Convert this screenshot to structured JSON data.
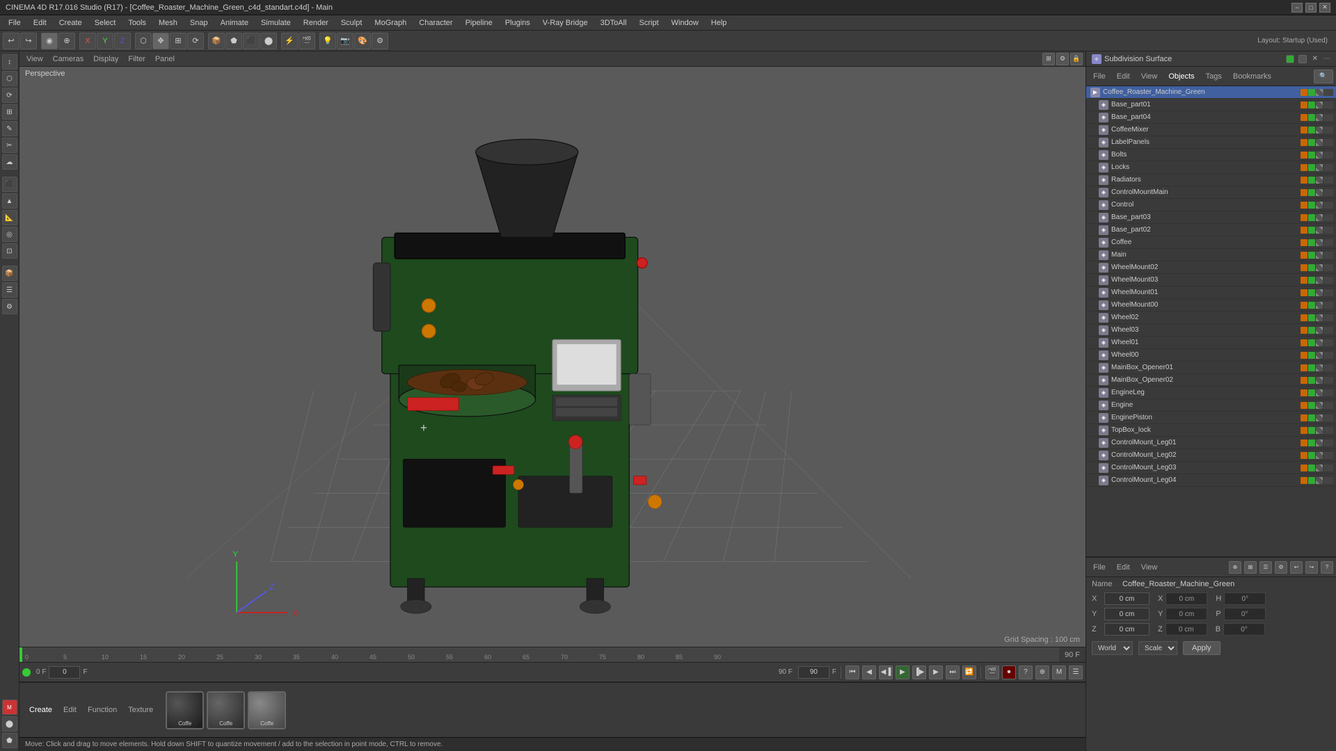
{
  "titlebar": {
    "title": "CINEMA 4D R17.016 Studio (R17) - [Coffee_Roaster_Machine_Green_c4d_standart.c4d] - Main",
    "min": "−",
    "max": "□",
    "close": "✕"
  },
  "menubar": {
    "items": [
      "File",
      "Edit",
      "Create",
      "Select",
      "Tools",
      "Mesh",
      "Snap",
      "Animate",
      "Simulate",
      "Render",
      "Sculpt",
      "MoGraph",
      "Character",
      "Pipeline",
      "Plugins",
      "V-Ray Bridge",
      "3DToAll",
      "Script",
      "Window",
      "Help"
    ]
  },
  "layout": {
    "label": "Layout: Startup (Used)"
  },
  "icons": {
    "undo": "↩",
    "redo": "↪",
    "move": "✥",
    "scale": "⊞",
    "rotate": "⟳",
    "play": "▶",
    "stop": "■",
    "rewind": "◀◀",
    "render": "⚡"
  },
  "viewport": {
    "perspective": "Perspective",
    "tabs": [
      "View",
      "Cameras",
      "Display",
      "Filter",
      "Panel"
    ],
    "grid_spacing": "Grid Spacing : 100 cm"
  },
  "toolbar_main": {
    "buttons": [
      "↩",
      "↪",
      "⊙",
      "◉",
      "🔄",
      "X",
      "Y",
      "Z",
      "📦",
      "✋",
      "🖊",
      "🔺",
      "⬡",
      "🔲",
      "💡",
      "🎬",
      "🏃",
      "📷",
      "⚙"
    ]
  },
  "left_tools": {
    "items": [
      "↕",
      "⬡",
      "⟳",
      "⊞",
      "✎",
      "✂",
      "☁",
      "⬛",
      "▲",
      "📐",
      "◎",
      "⊡",
      "📦",
      "☰",
      "⚙",
      "⬤"
    ]
  },
  "object_manager": {
    "tabs": [
      "File",
      "Edit",
      "View",
      "Objects",
      "Tags",
      "Bookmarks"
    ],
    "active_tab": "Objects",
    "subdiv_surface": "Subdivision Surface",
    "objects": [
      {
        "name": "Coffee_Roaster_Machine_Green",
        "level": 0,
        "type": "folder"
      },
      {
        "name": "Base_part01",
        "level": 1,
        "type": "mesh"
      },
      {
        "name": "Base_part04",
        "level": 1,
        "type": "mesh"
      },
      {
        "name": "CoffeeMixer",
        "level": 1,
        "type": "mesh"
      },
      {
        "name": "LabelPanels",
        "level": 1,
        "type": "mesh"
      },
      {
        "name": "Bolts",
        "level": 1,
        "type": "mesh"
      },
      {
        "name": "Locks",
        "level": 1,
        "type": "mesh"
      },
      {
        "name": "Radiators",
        "level": 1,
        "type": "mesh"
      },
      {
        "name": "ControlMountMain",
        "level": 1,
        "type": "mesh"
      },
      {
        "name": "Control",
        "level": 1,
        "type": "mesh"
      },
      {
        "name": "Base_part03",
        "level": 1,
        "type": "mesh"
      },
      {
        "name": "Base_part02",
        "level": 1,
        "type": "mesh"
      },
      {
        "name": "Coffee",
        "level": 1,
        "type": "mesh"
      },
      {
        "name": "Main",
        "level": 1,
        "type": "mesh"
      },
      {
        "name": "WheelMount02",
        "level": 1,
        "type": "mesh"
      },
      {
        "name": "WheelMount03",
        "level": 1,
        "type": "mesh"
      },
      {
        "name": "WheelMount01",
        "level": 1,
        "type": "mesh"
      },
      {
        "name": "WheelMount00",
        "level": 1,
        "type": "mesh"
      },
      {
        "name": "Wheel02",
        "level": 1,
        "type": "mesh"
      },
      {
        "name": "Wheel03",
        "level": 1,
        "type": "mesh"
      },
      {
        "name": "Wheel01",
        "level": 1,
        "type": "mesh"
      },
      {
        "name": "Wheel00",
        "level": 1,
        "type": "mesh"
      },
      {
        "name": "MainBox_Opener01",
        "level": 1,
        "type": "mesh"
      },
      {
        "name": "MainBox_Opener02",
        "level": 1,
        "type": "mesh"
      },
      {
        "name": "EngineLeg",
        "level": 1,
        "type": "mesh"
      },
      {
        "name": "Engine",
        "level": 1,
        "type": "mesh"
      },
      {
        "name": "EnginePiston",
        "level": 1,
        "type": "mesh"
      },
      {
        "name": "TopBox_lock",
        "level": 1,
        "type": "mesh"
      },
      {
        "name": "ControlMount_Leg01",
        "level": 1,
        "type": "mesh"
      },
      {
        "name": "ControlMount_Leg02",
        "level": 1,
        "type": "mesh"
      },
      {
        "name": "ControlMount_Leg03",
        "level": 1,
        "type": "mesh"
      },
      {
        "name": "ControlMount_Leg04",
        "level": 1,
        "type": "mesh"
      }
    ]
  },
  "attributes": {
    "tabs": [
      "File",
      "Edit",
      "View"
    ],
    "name_label": "Name",
    "name_value": "Coffee_Roaster_Machine_Green",
    "coords": [
      {
        "axis": "X",
        "value": "0 cm",
        "label": "X",
        "rvalue": "0 cm"
      },
      {
        "axis": "Y",
        "value": "0 cm",
        "label": "Y",
        "rvalue": "0 cm"
      },
      {
        "axis": "Z",
        "value": "0 cm",
        "label": "Z",
        "rvalue": "0 cm"
      }
    ],
    "h_label": "H",
    "h_value": "0°",
    "p_label": "P",
    "p_value": "0°",
    "b_label": "B",
    "b_value": "0°",
    "world_label": "World",
    "scale_label": "Scale",
    "apply_label": "Apply"
  },
  "materials": {
    "tabs": [
      "Create",
      "Edit",
      "Function",
      "Texture"
    ],
    "items": [
      {
        "label": "Coffe",
        "color1": "#3a3a3a",
        "color2": "#555"
      },
      {
        "label": "Coffe",
        "color1": "#555",
        "color2": "#3a3a3a"
      },
      {
        "label": "Coffe",
        "color1": "#888",
        "color2": "#aaa"
      }
    ]
  },
  "timeline": {
    "markers": [
      "0",
      "5",
      "10",
      "15",
      "20",
      "25",
      "30",
      "35",
      "40",
      "45",
      "50",
      "55",
      "60",
      "65",
      "70",
      "75",
      "80",
      "85",
      "90"
    ],
    "frame_label": "0 F",
    "end_label": "90 F"
  },
  "status": {
    "message": "Move: Click and drag to move elements. Hold down SHIFT to quantize movement / add to the selection in point mode, CTRL to remove."
  }
}
